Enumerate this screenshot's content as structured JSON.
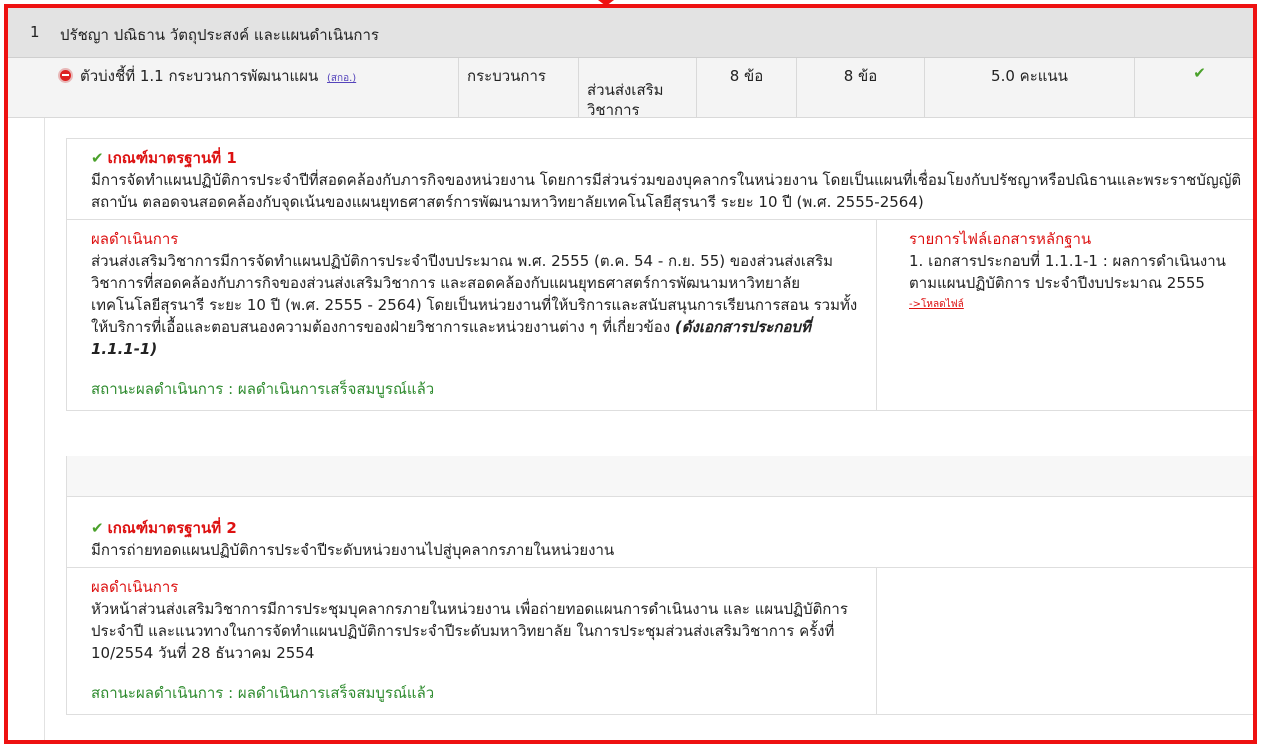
{
  "section": {
    "number": "1",
    "title": "ปรัชญา ปณิธาน วัตถุประสงค์ และแผนดำเนินการ"
  },
  "indicator": {
    "label": "ตัวบ่งชี้ที่ 1.1 กระบวนการพัฒนาแผน",
    "tag": "(สกอ.)",
    "type": "กระบวนการ",
    "unit": "ส่วนส่งเสริม\nวิชาการ",
    "target": "8 ข้อ",
    "achieved": "8 ข้อ",
    "score": "5.0 คะแนน",
    "status_icon": "check-icon"
  },
  "criteria": [
    {
      "title": "เกณฑ์มาตรฐานที่ 1",
      "description": "มีการจัดทำแผนปฏิบัติการประจำปีที่สอดคล้องกับภารกิจของหน่วยงาน โดยการมีส่วนร่วมของบุคลากรในหน่วยงาน โดยเป็นแผนที่เชื่อมโยงกับปรัชญาหรือปณิธานและพระราชบัญญัติสถาบัน ตลอดจนสอดคล้องกับจุดเน้นของแผนยุทธศาสตร์การพัฒนามหาวิทยาลัยเทคโนโลยีสุรนารี ระยะ 10 ปี (พ.ศ. 2555-2564)",
      "result_label": "ผลดำเนินการ",
      "result_text": "ส่วนส่งเสริมวิชาการมีการจัดทำแผนปฏิบัติการประจำปีงบประมาณ พ.ศ. 2555 (ต.ค. 54 - ก.ย. 55) ของส่วนส่งเสริมวิชาการที่สอดคล้องกับภารกิจของส่วนส่งเสริมวิชาการ และสอดคล้องกับแผนยุทธศาสตร์การพัฒนามหาวิทยาลัยเทคโนโลยีสุรนารี ระยะ 10 ปี (พ.ศ. 2555 - 2564) โดยเป็นหน่วยงานที่ให้บริการและสนับสนุนการเรียนการสอน รวมทั้งให้บริการที่เอื้อและตอบสนองความต้องการของฝ่ายวิชาการและหน่วยงานต่าง ๆ ที่เกี่ยวข้อง ",
      "result_doc_ref": "(ดังเอกสารประกอบที่ 1.1.1-1)",
      "status_text": "สถานะผลดำเนินการ : ผลดำเนินการเสร็จสมบูรณ์แล้ว",
      "files_label": "รายการไฟล์เอกสารหลักฐาน",
      "file_item": "1. เอกสารประกอบที่ 1.1.1-1 : ผลการดำเนินงานตามแผนปฏิบัติการ ประจำปีงบประมาณ 2555",
      "download_label": "->โหลดไฟล์"
    },
    {
      "title": "เกณฑ์มาตรฐานที่ 2",
      "description": "มีการถ่ายทอดแผนปฏิบัติการประจำปีระดับหน่วยงานไปสู่บุคลากรภายในหน่วยงาน",
      "result_label": "ผลดำเนินการ",
      "result_text": "หัวหน้าส่วนส่งเสริมวิชาการมีการประชุมบุคลากรภายในหน่วยงาน เพื่อถ่ายทอดแผนการดำเนินงาน และ แผนปฏิบัติการประจำปี และแนวทางในการจัดทำแผนปฏิบัติการประจำปีระดับมหาวิทยาลัย ในการประชุมส่วนส่งเสริมวิชาการ ครั้งที่ 10/2554 วันที่ 28 ธันวาคม 2554",
      "status_text": "สถานะผลดำเนินการ : ผลดำเนินการเสร็จสมบูรณ์แล้ว"
    }
  ]
}
